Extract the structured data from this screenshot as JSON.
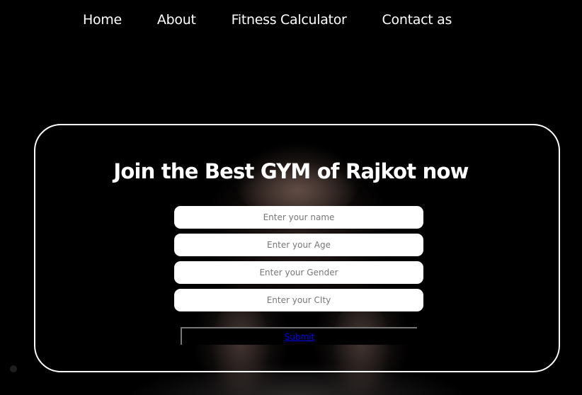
{
  "nav": {
    "items": [
      {
        "label": "Home"
      },
      {
        "label": "About"
      },
      {
        "label": "Fitness Calculator"
      },
      {
        "label": "Contact as"
      }
    ]
  },
  "form": {
    "title": "Join the Best GYM of Rajkot now",
    "fields": [
      {
        "placeholder": "Enter your name",
        "value": ""
      },
      {
        "placeholder": "Enter your Age",
        "value": ""
      },
      {
        "placeholder": "Enter your Gender",
        "value": ""
      },
      {
        "placeholder": "Enter your CIty",
        "value": ""
      }
    ],
    "submit_label": "Submit"
  },
  "colors": {
    "background": "#000000",
    "text": "#ffffff",
    "link": "#0000ee",
    "card_border": "#ffffff"
  }
}
